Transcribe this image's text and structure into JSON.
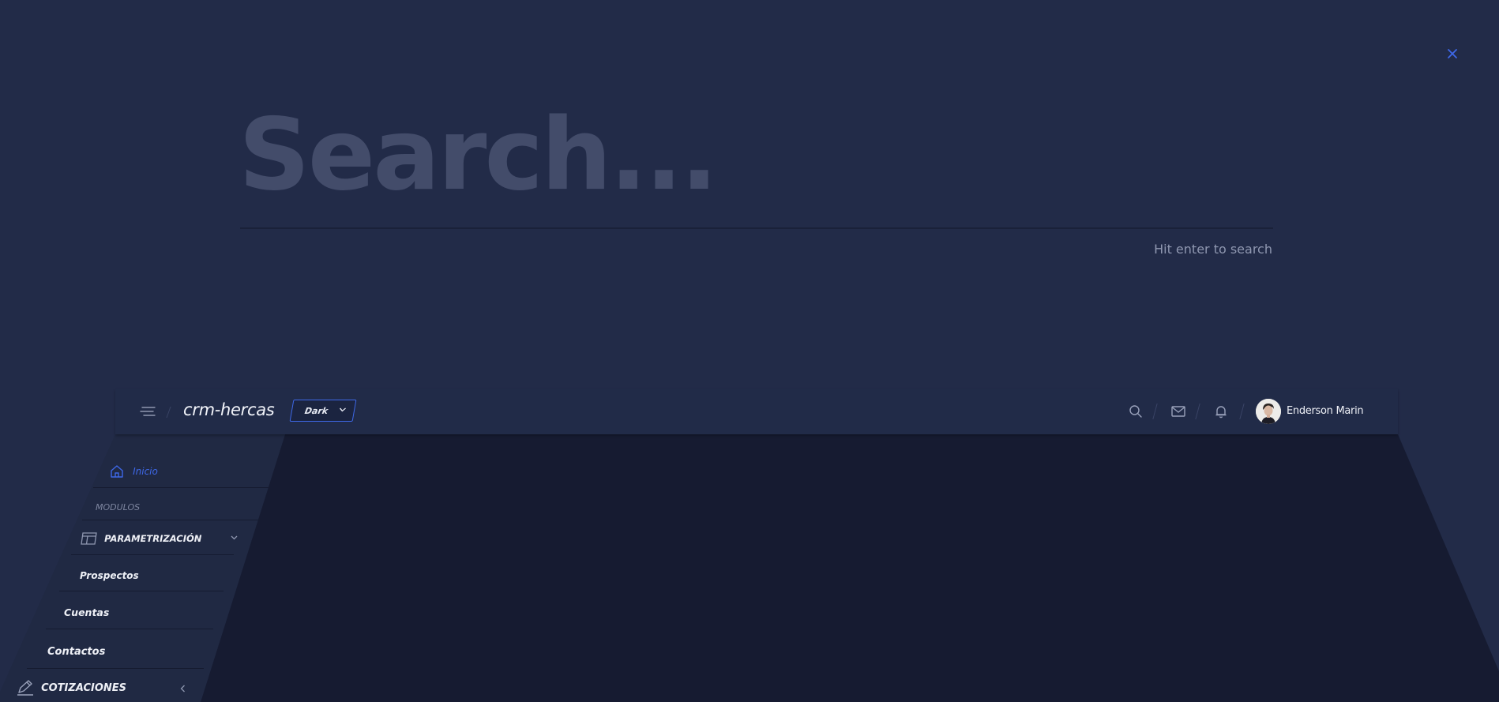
{
  "search": {
    "placeholder": "Search...",
    "hint": "Hit enter to search"
  },
  "topbar": {
    "app_name": "crm-hercas",
    "theme_select": "Dark",
    "user_name": "Enderson Marin"
  },
  "sidebar": {
    "home_label": "Inicio",
    "section_label": "MODULOS",
    "parametrizacion_label": "PARAMETRIZACIÓN",
    "prospectos_label": "Prospectos",
    "cuentas_label": "Cuentas",
    "contactos_label": "Contactos",
    "cotizaciones_label": "COTIZACIONES"
  },
  "colors": {
    "background": "#222b48",
    "accent": "#3e68e8",
    "content": "#161b31"
  }
}
